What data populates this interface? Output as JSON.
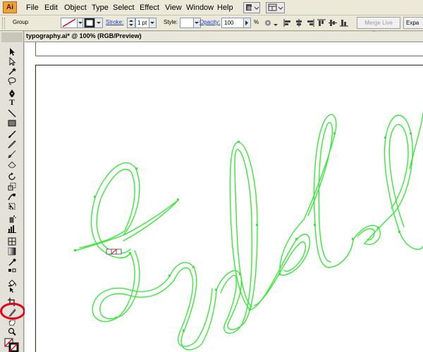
{
  "app": {
    "logo_text": "Ai"
  },
  "menubar": {
    "items": [
      "File",
      "Edit",
      "Object",
      "Type",
      "Select",
      "Effect",
      "View",
      "Window",
      "Help"
    ]
  },
  "controlbar": {
    "selection_label": "Group",
    "stroke_label": "Stroke:",
    "stroke_value": "1 pt",
    "style_label": "Style:",
    "opacity_label": "Opacity:",
    "opacity_value": "100",
    "percent": "%",
    "merge_live_paint": "Merge Live Paint",
    "expand": "Expa"
  },
  "document": {
    "tab_title": "typography.ai* @ 100% (RGB/Preview)"
  },
  "colors": {
    "path_green": "#39e83a",
    "highlight_red": "#e0001b",
    "link_blue": "#1a3fc4"
  },
  "tools": [
    "selection-tool",
    "direct-selection-tool",
    "magic-wand-tool",
    "lasso-tool",
    "pen-tool",
    "type-tool",
    "line-segment-tool",
    "rectangle-tool",
    "paintbrush-tool",
    "pencil-tool",
    "blob-brush-tool",
    "eraser-tool",
    "rotate-tool",
    "scale-tool",
    "warp-tool",
    "free-transform-tool",
    "symbol-sprayer-tool",
    "column-graph-tool",
    "mesh-tool",
    "gradient-tool",
    "eyedropper-tool",
    "live-paint-bucket-tool",
    "live-paint-selection-tool",
    "crop-area-tool",
    "slice-tool",
    "hand-tool",
    "zoom-tool",
    "fill-stroke-swatches"
  ]
}
